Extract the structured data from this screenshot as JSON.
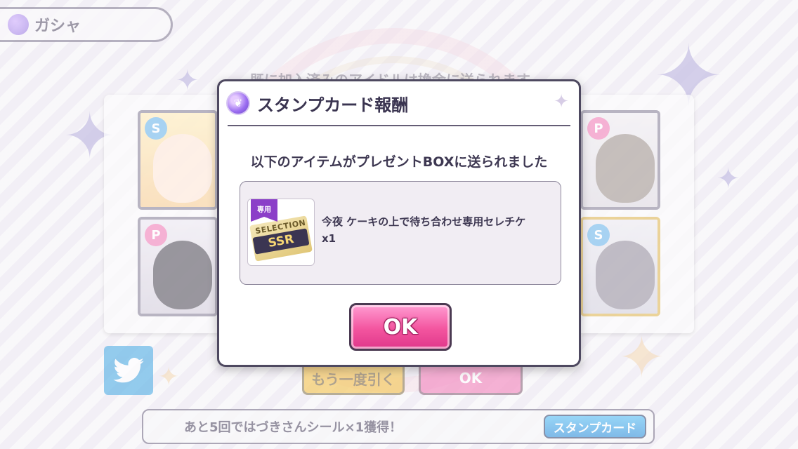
{
  "screen": {
    "title": "ガシャ",
    "notice": "既に加入済みのアイドルは換金に送られます",
    "twitter_icon": "twitter-bird-icon",
    "retry_label": "もう一度引く",
    "ok_label": "OK",
    "stamp_progress": "あと5回ではづきさんシール×1獲得！",
    "stamp_card_button": "スタンプカード",
    "cards": [
      {
        "badge": "S",
        "badge_color": "#4aa6e8",
        "frame": "normal"
      },
      {
        "badge": "P",
        "badge_color": "#ee5fa8",
        "frame": "normal"
      },
      {
        "badge": "P",
        "badge_color": "#ee5fa8",
        "frame": "normal"
      },
      {
        "badge": "S",
        "badge_color": "#4aa6e8",
        "frame": "gold"
      }
    ]
  },
  "modal": {
    "title": "スタンプカード報酬",
    "message": "以下のアイテムがプレゼントBOXに送られました",
    "reward": {
      "ribbon": "専用",
      "selection_text": "SELECTION",
      "rarity": "SSR",
      "name": "今夜 ケーキの上で待ち合わせ専用セレチケ",
      "quantity": "x1"
    },
    "ok_label": "OK"
  },
  "colors": {
    "ok_pink": "#f3559f",
    "twitter_blue": "#1d95dc",
    "stamp_blue": "#1c86d8",
    "frame_dark": "#4e4960"
  }
}
